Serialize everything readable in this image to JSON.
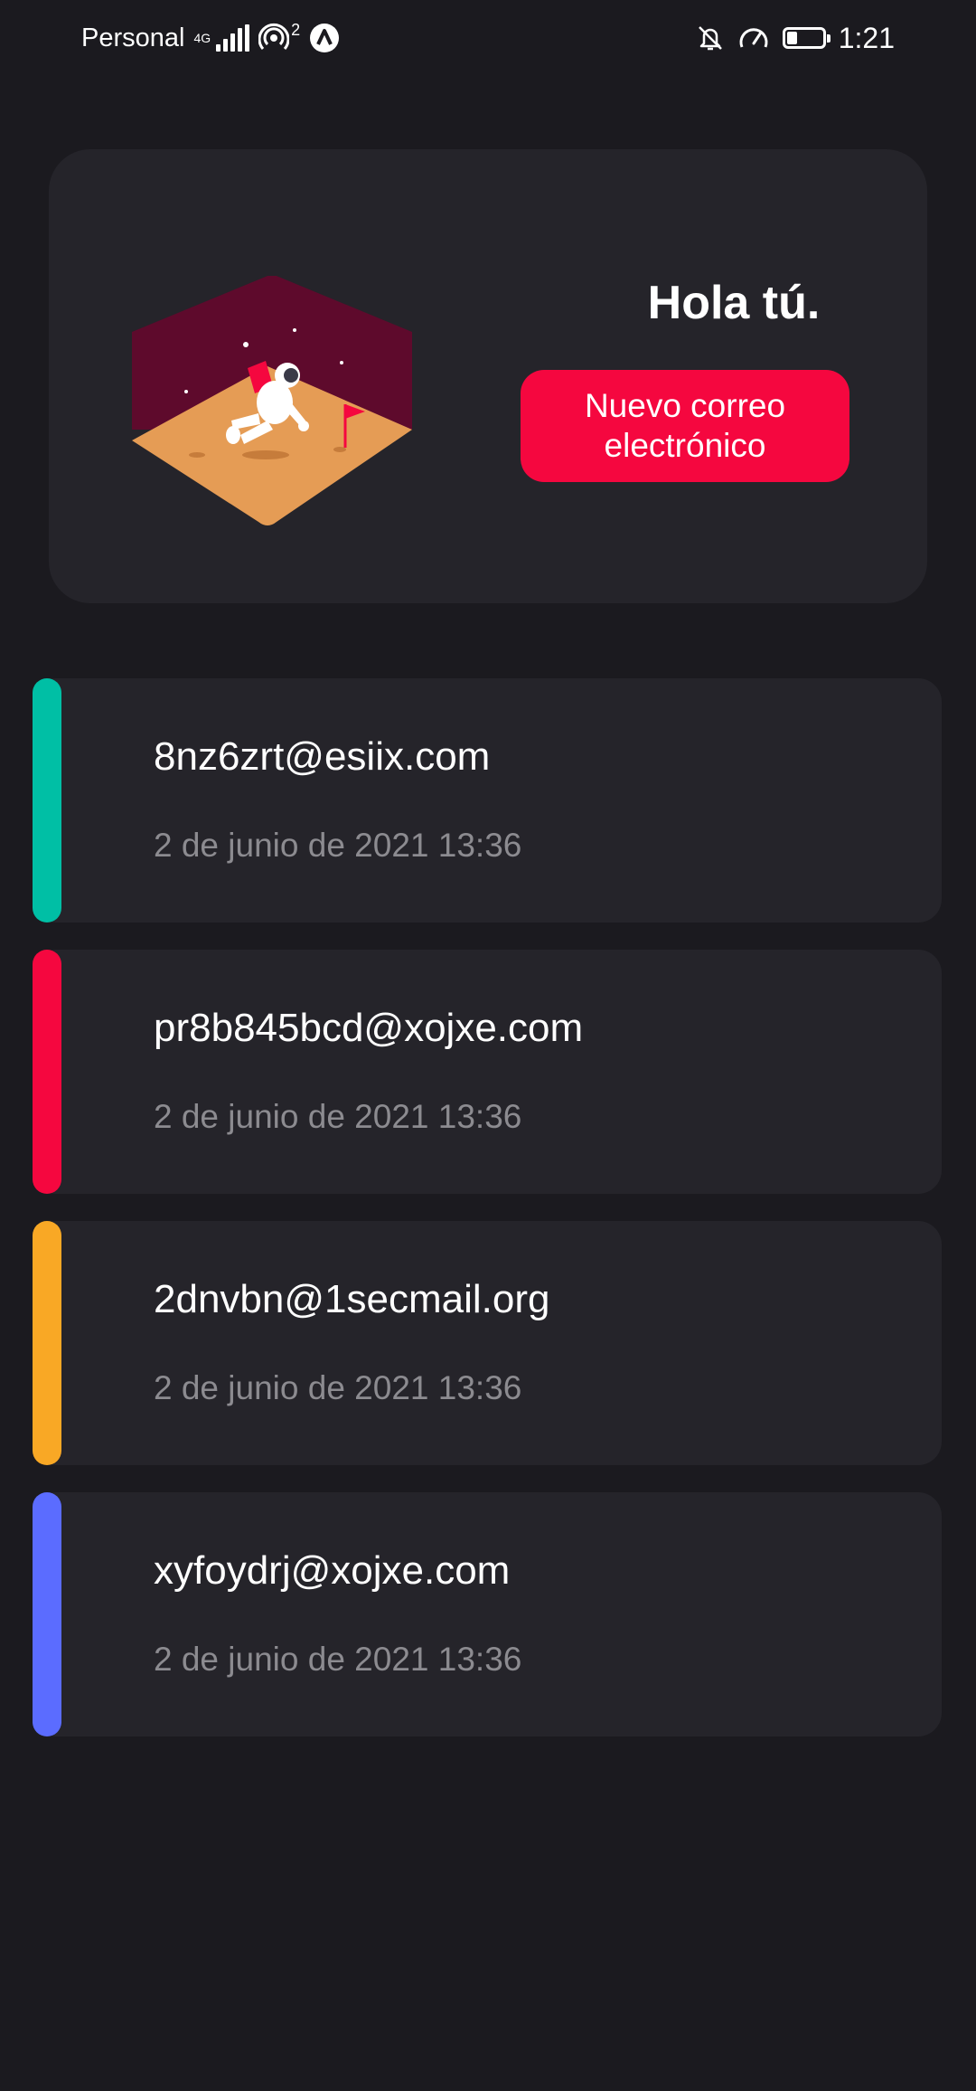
{
  "status_bar": {
    "carrier": "Personal",
    "network_type": "4G",
    "hotspot_count": "2",
    "time": "1:21",
    "battery_level": 0.3,
    "icons": [
      "signal-icon",
      "hotspot-icon",
      "app-notification-icon",
      "bell-off-icon",
      "speedometer-icon",
      "battery-icon"
    ]
  },
  "hero": {
    "greeting": "Hola tú.",
    "new_email_button": "Nuevo correo electrónico",
    "illustration": "astronaut-on-planet-illustration"
  },
  "mail_items": [
    {
      "address": "8nz6zrt@esiix.com",
      "date": "2 de junio de 2021 13:36",
      "accent": "#00bfa5"
    },
    {
      "address": "pr8b845bcd@xojxe.com",
      "date": "2 de junio de 2021 13:36",
      "accent": "#f5073f"
    },
    {
      "address": "2dnvbn@1secmail.org",
      "date": "2 de junio de 2021 13:36",
      "accent": "#f9a825"
    },
    {
      "address": "xyfoydrj@xojxe.com",
      "date": "2 de junio de 2021 13:36",
      "accent": "#5b6cff"
    }
  ],
  "colors": {
    "background": "#1b1a1f",
    "card": "#25242a",
    "primary": "#f5073f",
    "secondary_text": "#8c8b90"
  }
}
